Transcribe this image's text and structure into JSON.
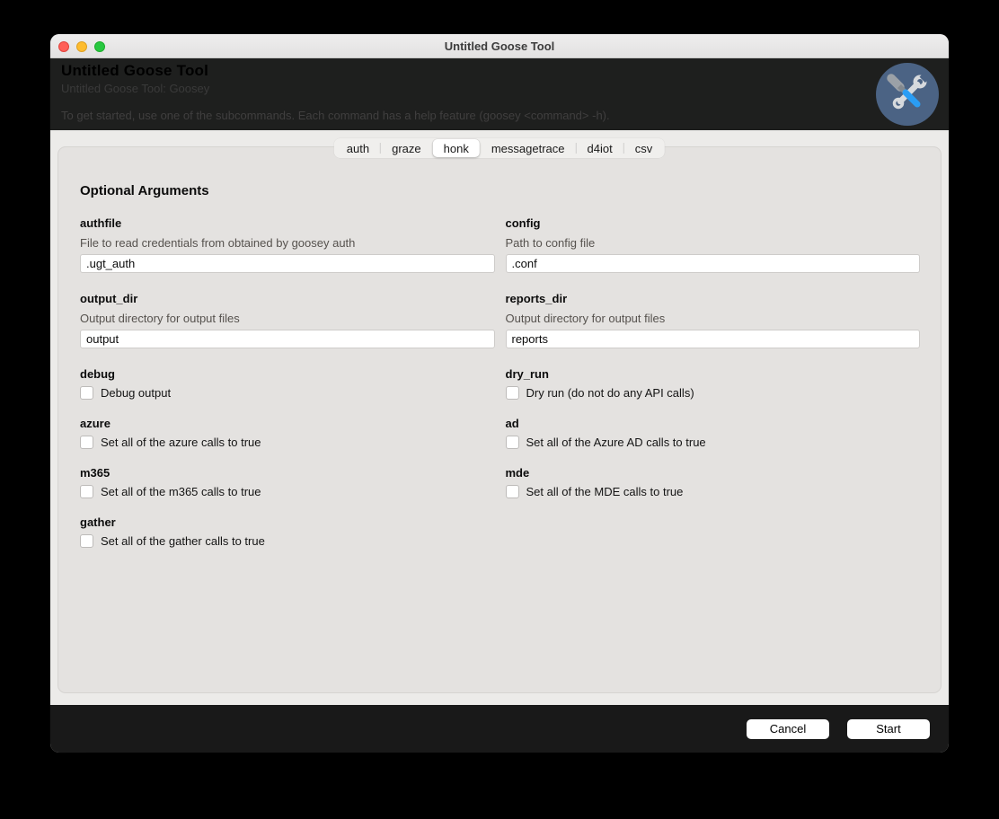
{
  "window": {
    "title": "Untitled Goose Tool"
  },
  "header": {
    "title": "Untitled Goose Tool",
    "subtitle": "Untitled Goose Tool: Goosey",
    "instructions": "To get started, use one of the subcommands. Each command has a help feature (goosey <command> -h)."
  },
  "icon": {
    "name": "wrench-screwdriver-icon",
    "circle_color": "#4b6384",
    "wrench_color": "#d7dadd",
    "handle_color": "#9ba1a7",
    "blade_color": "#2a9df4"
  },
  "tabs": {
    "selected": "honk",
    "items": [
      {
        "label": "auth"
      },
      {
        "label": "graze"
      },
      {
        "label": "honk"
      },
      {
        "label": "messagetrace"
      },
      {
        "label": "d4iot"
      },
      {
        "label": "csv"
      }
    ]
  },
  "form": {
    "heading": "Optional Arguments",
    "text_fields": [
      {
        "name": "authfile",
        "description": "File to read credentials from obtained by goosey auth",
        "value": ".ugt_auth"
      },
      {
        "name": "config",
        "description": "Path to config file",
        "value": ".conf"
      },
      {
        "name": "output_dir",
        "description": "Output directory for output files",
        "value": "output"
      },
      {
        "name": "reports_dir",
        "description": "Output directory for output files",
        "value": "reports"
      }
    ],
    "checkbox_fields": [
      {
        "name": "debug",
        "label": "Debug output",
        "checked": false
      },
      {
        "name": "dry_run",
        "label": "Dry run (do not do any API calls)",
        "checked": false
      },
      {
        "name": "azure",
        "label": "Set all of the azure calls to true",
        "checked": false
      },
      {
        "name": "ad",
        "label": "Set all of the Azure AD calls to true",
        "checked": false
      },
      {
        "name": "m365",
        "label": "Set all of the m365 calls to true",
        "checked": false
      },
      {
        "name": "mde",
        "label": "Set all of the MDE calls to true",
        "checked": false
      },
      {
        "name": "gather",
        "label": "Set all of the gather calls to true",
        "checked": false
      }
    ]
  },
  "footer": {
    "cancel_label": "Cancel",
    "start_label": "Start"
  }
}
